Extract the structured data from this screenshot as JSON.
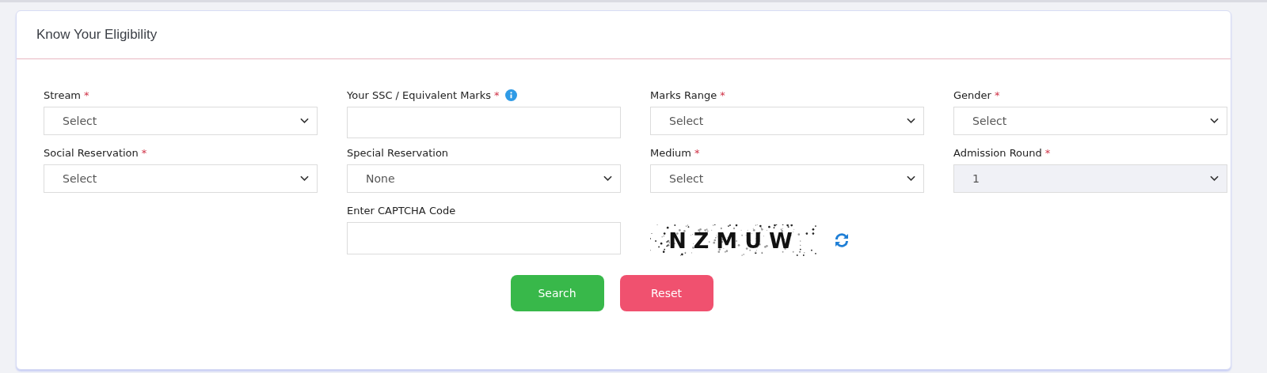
{
  "card": {
    "title": "Know Your Eligibility"
  },
  "required_symbol": "*",
  "fields": [
    {
      "label": "Stream",
      "required": true,
      "kind": "select",
      "value": "Select",
      "disabled": false
    },
    {
      "label": "Your SSC / Equivalent Marks",
      "required": true,
      "kind": "text",
      "info": true
    },
    {
      "label": "Marks Range",
      "required": true,
      "kind": "select",
      "value": "Select",
      "disabled": false
    },
    {
      "label": "Gender",
      "required": true,
      "kind": "select",
      "value": "Select",
      "disabled": false
    },
    {
      "label": "Social Reservation",
      "required": true,
      "kind": "select",
      "value": "Select",
      "disabled": false
    },
    {
      "label": "Special Reservation",
      "required": false,
      "kind": "select",
      "value": "None",
      "disabled": false
    },
    {
      "label": "Medium",
      "required": true,
      "kind": "select",
      "value": "Select",
      "disabled": false
    },
    {
      "label": "Admission Round",
      "required": true,
      "kind": "select",
      "value": "1",
      "disabled": true
    }
  ],
  "captcha": {
    "label": "Enter CAPTCHA Code",
    "code": "NZMUW"
  },
  "buttons": [
    {
      "label": "Search",
      "kind": "primary"
    },
    {
      "label": "Reset",
      "kind": "danger"
    }
  ]
}
